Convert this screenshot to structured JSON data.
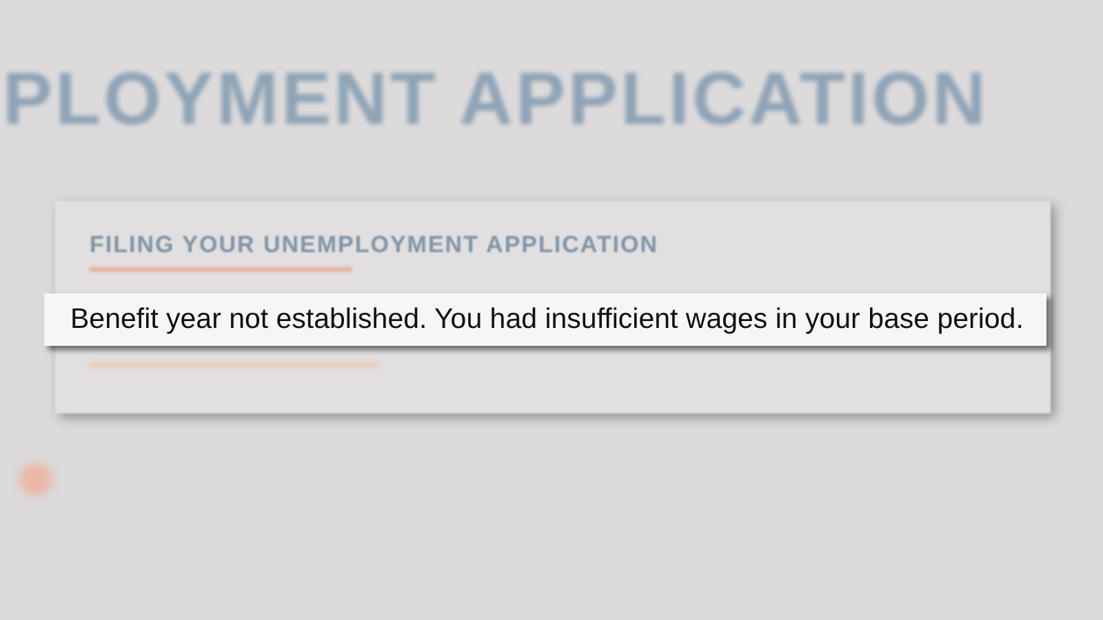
{
  "page": {
    "title": "PLOYMENT APPLICATION"
  },
  "card": {
    "heading": "FILING YOUR UNEMPLOYMENT APPLICATION"
  },
  "notice": {
    "text": "Benefit year not established. You had insufficient wages in your base period."
  }
}
